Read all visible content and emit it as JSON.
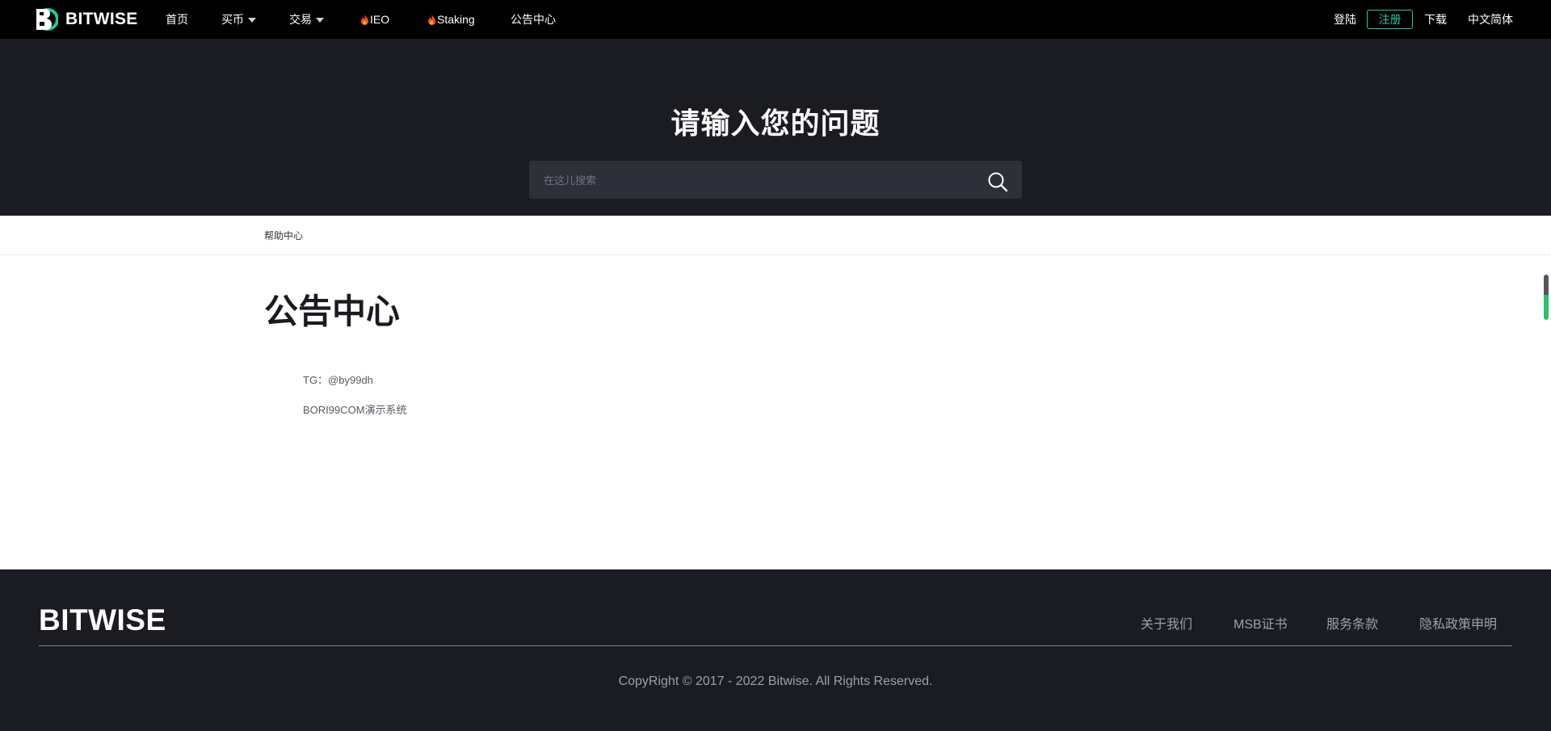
{
  "brand": {
    "name": "BITWISE",
    "accent_color": "#23c8a0"
  },
  "nav": {
    "home": "首页",
    "buy": "买币",
    "trade": "交易",
    "ieo": "IEO",
    "staking": "Staking",
    "announcements": "公告中心",
    "login": "登陆",
    "register": "注册",
    "download": "下载",
    "language": "中文简体"
  },
  "hero": {
    "title": "请输入您的问题",
    "search_placeholder": "在这儿搜索"
  },
  "breadcrumb": {
    "label": "帮助中心"
  },
  "main": {
    "title": "公告中心",
    "lines": [
      "TG：@by99dh",
      "BORI99COM演示系统"
    ]
  },
  "footer": {
    "logo": "BITWISE",
    "links": [
      "关于我们",
      "MSB证书",
      "服务条款",
      "隐私政策申明"
    ],
    "copyright": "CopyRight © 2017 - 2022 Bitwise. All Rights Reserved."
  },
  "icons": {
    "logo": "bitwise-b-logo-icon",
    "menu_dropdown": "chevron-down-icon",
    "hot": "fire-icon",
    "search": "search-icon"
  }
}
